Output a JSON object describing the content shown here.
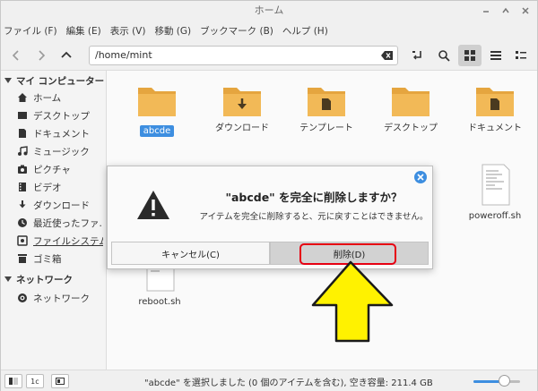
{
  "window": {
    "title": "ホーム"
  },
  "menubar": {
    "items": [
      "ファイル (F)",
      "編集 (E)",
      "表示 (V)",
      "移動 (G)",
      "ブックマーク (B)",
      "ヘルプ (H)"
    ]
  },
  "toolbar": {
    "path": "/home/mint"
  },
  "sidebar": {
    "sections": [
      {
        "label": "マイ コンピューター",
        "items": [
          {
            "label": "ホーム",
            "icon": "home-icon"
          },
          {
            "label": "デスクトップ",
            "icon": "desktop-icon"
          },
          {
            "label": "ドキュメント",
            "icon": "document-icon"
          },
          {
            "label": "ミュージック",
            "icon": "music-icon"
          },
          {
            "label": "ピクチャ",
            "icon": "camera-icon"
          },
          {
            "label": "ビデオ",
            "icon": "video-icon"
          },
          {
            "label": "ダウンロード",
            "icon": "download-icon"
          },
          {
            "label": "最近使ったファ...",
            "icon": "recent-icon"
          },
          {
            "label": "ファイルシステム",
            "icon": "drive-icon"
          },
          {
            "label": "ゴミ箱",
            "icon": "trash-icon"
          }
        ]
      },
      {
        "label": "ネットワーク",
        "items": [
          {
            "label": "ネットワーク",
            "icon": "network-icon"
          }
        ]
      }
    ]
  },
  "files": [
    {
      "name": "abcde",
      "kind": "folder"
    },
    {
      "name": "ダウンロード",
      "kind": "folder",
      "emblem": "download"
    },
    {
      "name": "テンプレート",
      "kind": "folder",
      "emblem": "document"
    },
    {
      "name": "デスクトップ",
      "kind": "folder"
    },
    {
      "name": "ドキュメント",
      "kind": "folder",
      "emblem": "document"
    },
    {
      "name": "poweroff.sh",
      "kind": "script"
    },
    {
      "name": "reboot.sh",
      "kind": "script"
    }
  ],
  "dialog": {
    "title": "\"abcde\" を完全に削除しますか？",
    "message": "アイテムを完全に削除すると、元に戻すことはできません。",
    "cancel_label": "キャンセル(C)",
    "delete_label": "削除(D)"
  },
  "statusbar": {
    "text": "\"abcde\" を選択しました (0 個のアイテムを含む), 空き容量: 211.4 GB",
    "zoom_fraction": 0.65
  },
  "colors": {
    "folder": "#f2b957",
    "folder_tab": "#e5a53f",
    "accent": "#3d8ee0",
    "highlight": "#e60012",
    "arrow": "#fff200"
  }
}
